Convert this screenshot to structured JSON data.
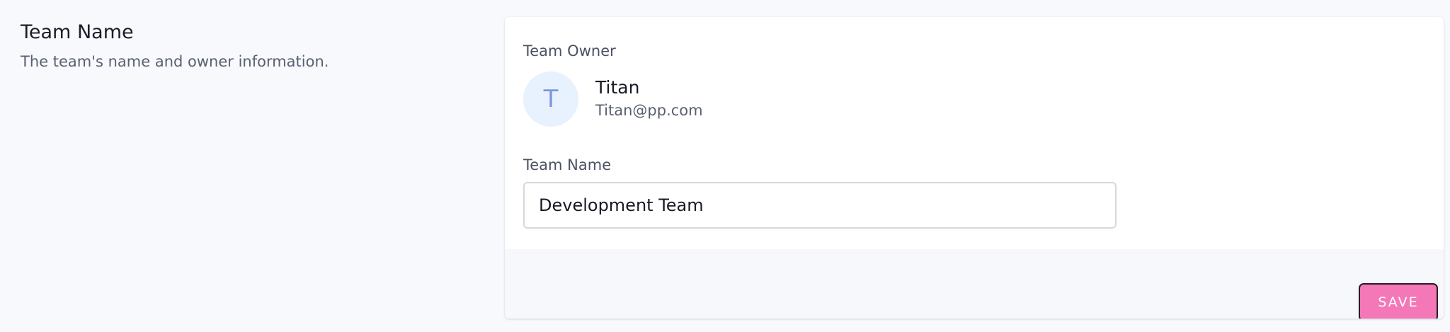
{
  "section": {
    "title": "Team Name",
    "description": "The team's name and owner information."
  },
  "owner": {
    "label": "Team Owner",
    "avatar_initial": "T",
    "name": "Titan",
    "email": "Titan@pp.com"
  },
  "team_name_field": {
    "label": "Team Name",
    "value": "Development Team"
  },
  "actions": {
    "save_label": "SAVE"
  },
  "colors": {
    "page_background": "#f7f9fd",
    "avatar_background": "#e8f1fe",
    "avatar_text": "#7d96e0",
    "save_button": "#f478b8"
  }
}
